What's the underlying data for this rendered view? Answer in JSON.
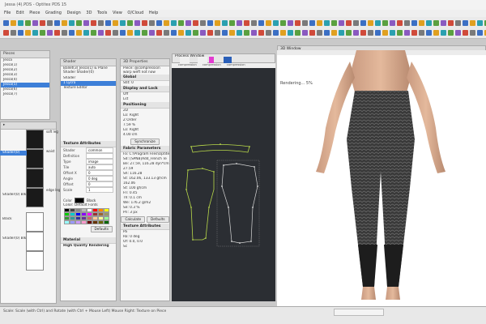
{
  "window": {
    "title": "Jessa (4).PDS - Optitex PDS 15"
  },
  "menu": [
    "File",
    "Edit",
    "Piece",
    "Grading",
    "Design",
    "3D",
    "Tools",
    "View",
    "O/Cloud",
    "Help"
  ],
  "pieces_list": {
    "header": "Pieces",
    "items": [
      "Jessa",
      "Jessa(1)",
      "Jessa(2)",
      "Jessa(3)",
      "Jessa(4)",
      "Jessa(5)",
      "Jessa(6)",
      "Jessa(7)"
    ],
    "selected_index": 5
  },
  "shader_panel": {
    "header": "Shader",
    "title": "Ballet(3) Jessa(1) & Plane Shader Shader(0)",
    "rows": [
      "Shader",
      "1 Lycra",
      "Texture Editor"
    ]
  },
  "thumbs": {
    "labels": [
      "soft leg",
      "waist ruched",
      "Shader(0)",
      "edge leg",
      "Shader(0) Blk",
      "Black",
      "Shader(0) Blk"
    ]
  },
  "texture_attributes": {
    "header": "Texture Attributes",
    "fields": [
      {
        "label": "Shader",
        "value": "common"
      },
      {
        "label": "Definition",
        "value": ""
      },
      {
        "label": "Type",
        "value": "image"
      },
      {
        "label": "Tile",
        "value": "auto"
      },
      {
        "label": "Offset X",
        "value": "0"
      },
      {
        "label": "Angle",
        "value": "0 deg"
      },
      {
        "label": "Offset",
        "value": "0"
      },
      {
        "label": "Scale",
        "value": "1"
      }
    ],
    "color_label": "Color",
    "color_value": "Black",
    "defaults_label": "Color: Default Fonts",
    "reset_button": "Defaults"
  },
  "material": {
    "header": "Material",
    "quality_label": "High Quality Rendering"
  },
  "properties": {
    "header": "3D Properties",
    "note": "Piece: @compression warp weft not now bagging",
    "sections": [
      {
        "title": "Global",
        "rows": [
          "Stit: 0"
        ]
      },
      {
        "title": "Display and Lock",
        "rows": [
          "Off",
          "Lst"
        ]
      },
      {
        "title": "Positioning",
        "rows": [
          "2D",
          "Lo: Right",
          "Z Order",
          "7.59 %",
          "Lo: Right",
          "4.00 cm"
        ]
      },
      {
        "title": "Fabric Parameters",
        "rows": [
          "Fa: C:\\Program Files\\Optitex",
          "Sd: [SPNB]Add_French Te",
          "Be: 27.59, 116.28 dyn*cm",
          "27.59",
          "Sh: 116.28",
          "St: 162.06, 133.13 gf/cm",
          "162.06",
          "St: 100 gf/cm",
          "Fri: 0.45",
          "Th: 0.1 cm",
          "We: 176.2 g/m2",
          "Se: 0.3 %",
          "Pri: 3 px"
        ]
      },
      {
        "title": "Texture Attributes",
        "rows": [
          "Pa",
          "Ro: 0 deg",
          "Of: 0.0, 0.0",
          "Sc"
        ]
      }
    ],
    "synchronize_button": "Synchronize",
    "calculate_button": "Calculate",
    "defaults_button": "Defaults"
  },
  "process_window": {
    "header": "Process Window",
    "tabs": [
      "compression",
      "compression",
      "compression"
    ]
  },
  "view3d": {
    "header": "3D Window",
    "status": "Rendering... 5%"
  },
  "status_bar": {
    "text": "Scale: Scale (with Ctrl) and Rotate (with Ctrl + Mouse Left)  Mouse Right: Texture on Piece"
  },
  "colors": {
    "accent": "#3d7fd8",
    "viewport_bg": "#2b2e33",
    "pattern_line": "#b8d84a",
    "pattern_white": "#d8d8d8"
  }
}
